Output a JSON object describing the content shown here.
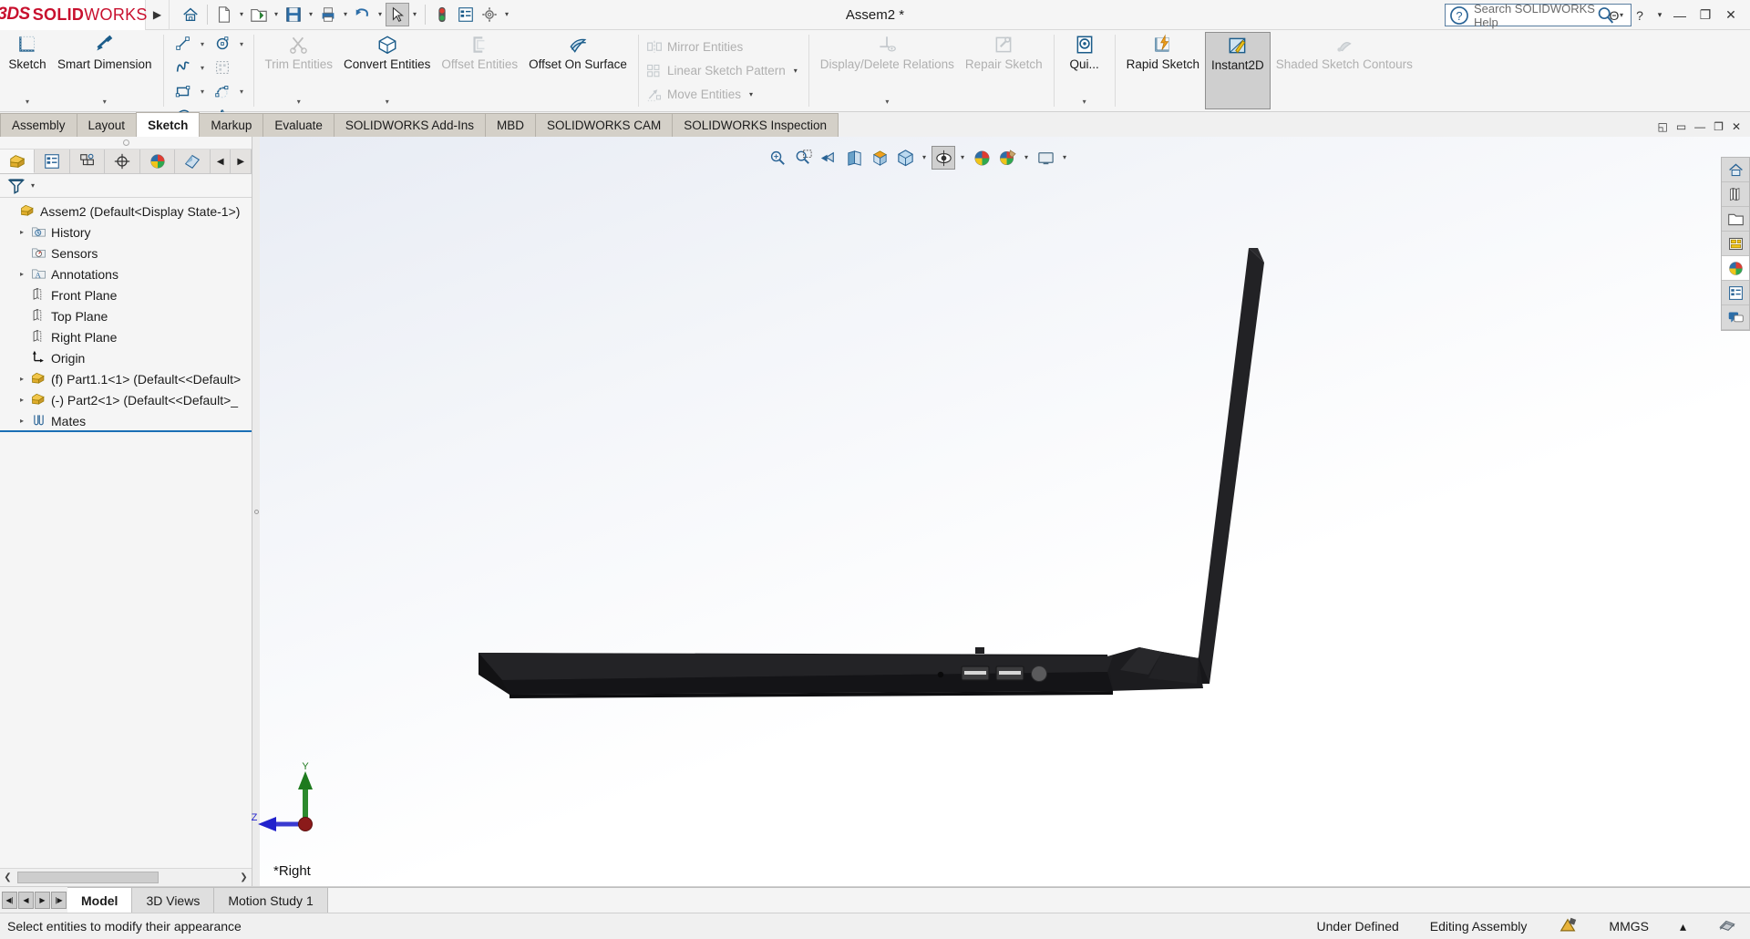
{
  "titlebar": {
    "logo_ds": "3DS",
    "logo_solid": "SOLID",
    "logo_works": "WORKS",
    "expand_arrow": "▶",
    "document_title": "Assem2 *",
    "quick_access": [
      {
        "name": "home-icon",
        "label": "Home",
        "caret": false
      },
      {
        "name": "new-document-icon",
        "label": "New",
        "caret": true
      },
      {
        "name": "open-folder-icon",
        "label": "Open",
        "caret": true
      },
      {
        "name": "save-icon",
        "label": "Save",
        "caret": true
      },
      {
        "name": "print-icon",
        "label": "Print",
        "caret": true
      },
      {
        "name": "undo-icon",
        "label": "Undo",
        "caret": true
      },
      {
        "name": "select-cursor-icon",
        "label": "Select",
        "caret": true
      },
      {
        "name": "rebuild-icon",
        "label": "Rebuild",
        "caret": false
      },
      {
        "name": "options-list-icon",
        "label": "File Properties",
        "caret": false
      },
      {
        "name": "gear-icon",
        "label": "Options",
        "caret": true
      }
    ],
    "search_placeholder": "Search SOLIDWORKS Help",
    "search_value": "",
    "search_icon": "search-magnifier-icon",
    "window_buttons": [
      {
        "name": "user-account-icon",
        "glyph": "Θ"
      },
      {
        "name": "help-icon",
        "glyph": "?"
      },
      {
        "name": "help-caret-icon",
        "glyph": "▾"
      },
      {
        "name": "minimize-button",
        "glyph": "—"
      },
      {
        "name": "restore-button",
        "glyph": "❐"
      },
      {
        "name": "close-button",
        "glyph": "✕"
      }
    ]
  },
  "ribbon": {
    "groups": [
      {
        "type": "big",
        "buttons": [
          {
            "label": "Sketch",
            "icon": "sketch-icon",
            "dropdown": true,
            "enabled": true,
            "active": false
          },
          {
            "label": "Smart Dimension",
            "icon": "smart-dimension-icon",
            "dropdown": true,
            "enabled": true,
            "active": false
          }
        ]
      },
      {
        "type": "grid",
        "cells": [
          {
            "icon": "line-icon",
            "caret": true
          },
          {
            "icon": "circle-icon",
            "caret": true
          },
          {
            "icon": "spline-icon",
            "caret": true
          },
          {
            "icon": "sketch-fillet-pattern-icon",
            "caret": false
          },
          {
            "icon": "rectangle-icon",
            "caret": true
          },
          {
            "icon": "arc-icon",
            "caret": true
          },
          {
            "icon": "ellipse-icon",
            "caret": true
          },
          {
            "icon": "text-icon",
            "caret": false
          },
          {
            "icon": "slot-icon",
            "caret": true
          },
          {
            "icon": "polygon-icon",
            "caret": true
          },
          {
            "icon": "fillet-corner-icon",
            "caret": true
          },
          {
            "icon": "point-icon",
            "caret": false
          }
        ]
      },
      {
        "type": "big",
        "buttons": [
          {
            "label": "Trim Entities",
            "icon": "trim-entities-icon",
            "dropdown": true,
            "enabled": false,
            "active": false
          },
          {
            "label": "Convert Entities",
            "icon": "convert-entities-icon",
            "dropdown": true,
            "enabled": true,
            "active": false
          },
          {
            "label": "Offset Entities",
            "icon": "offset-entities-icon",
            "dropdown": false,
            "enabled": false,
            "active": false
          },
          {
            "label": "Offset On Surface",
            "icon": "offset-on-surface-icon",
            "dropdown": false,
            "enabled": true,
            "active": false
          }
        ]
      },
      {
        "type": "textlist",
        "items": [
          {
            "label": "Mirror Entities",
            "icon": "mirror-entities-icon",
            "caret": false,
            "enabled": false
          },
          {
            "label": "Linear Sketch Pattern",
            "icon": "linear-sketch-pattern-icon",
            "caret": true,
            "enabled": false
          },
          {
            "label": "Move Entities",
            "icon": "move-entities-icon",
            "caret": true,
            "enabled": false
          }
        ]
      },
      {
        "type": "big",
        "buttons": [
          {
            "label": "Display/Delete Relations",
            "icon": "display-delete-relations-icon",
            "dropdown": true,
            "enabled": false,
            "active": false
          },
          {
            "label": "Repair Sketch",
            "icon": "repair-sketch-icon",
            "dropdown": false,
            "enabled": false,
            "active": false
          }
        ]
      },
      {
        "type": "big",
        "buttons": [
          {
            "label": "Qui...",
            "icon": "quick-snaps-icon",
            "dropdown": true,
            "enabled": true,
            "active": false
          }
        ]
      },
      {
        "type": "big",
        "buttons": [
          {
            "label": "Rapid Sketch",
            "icon": "rapid-sketch-icon",
            "dropdown": false,
            "enabled": true,
            "active": false
          },
          {
            "label": "Instant2D",
            "icon": "instant2d-icon",
            "dropdown": false,
            "enabled": true,
            "active": true
          },
          {
            "label": "Shaded Sketch Contours",
            "icon": "shaded-sketch-contours-icon",
            "dropdown": false,
            "enabled": false,
            "active": false
          }
        ]
      }
    ]
  },
  "command_tabs": {
    "tabs": [
      {
        "label": "Assembly",
        "selected": false
      },
      {
        "label": "Layout",
        "selected": false
      },
      {
        "label": "Sketch",
        "selected": true
      },
      {
        "label": "Markup",
        "selected": false
      },
      {
        "label": "Evaluate",
        "selected": false
      },
      {
        "label": "SOLIDWORKS Add-Ins",
        "selected": false
      },
      {
        "label": "MBD",
        "selected": false
      },
      {
        "label": "SOLIDWORKS CAM",
        "selected": false
      },
      {
        "label": "SOLIDWORKS Inspection",
        "selected": false
      }
    ],
    "window_controls": [
      {
        "name": "pin-panel-icon",
        "glyph": "◱"
      },
      {
        "name": "doc-minimize-icon",
        "glyph": "▭"
      },
      {
        "name": "doc-minimize-button",
        "glyph": "—"
      },
      {
        "name": "doc-restore-button",
        "glyph": "❐"
      },
      {
        "name": "doc-close-button",
        "glyph": "✕"
      }
    ]
  },
  "left_panel": {
    "tree_tabs": [
      {
        "name": "feature-manager-tab",
        "icon": "yellow-block-icon",
        "selected": true
      },
      {
        "name": "property-manager-tab",
        "icon": "property-list-icon",
        "selected": false
      },
      {
        "name": "configuration-manager-tab",
        "icon": "configuration-icon",
        "selected": false
      },
      {
        "name": "dimxpert-manager-tab",
        "icon": "dimxpert-target-icon",
        "selected": false
      },
      {
        "name": "display-manager-tab",
        "icon": "appearance-sphere-icon",
        "selected": false
      },
      {
        "name": "render-manager-tab",
        "icon": "render-pages-icon",
        "selected": false
      }
    ],
    "tab_scroll_left": "◀",
    "tab_scroll_right": "▶",
    "filter_icon": "filter-funnel-icon",
    "filter_caret": "▾",
    "tree_items": [
      {
        "label": "Assem2  (Default<Display State-1>)",
        "icon": "assembly-icon",
        "indent": 0,
        "expander": ""
      },
      {
        "label": "History",
        "icon": "history-folder-icon",
        "indent": 1,
        "expander": "▸"
      },
      {
        "label": "Sensors",
        "icon": "sensors-icon",
        "indent": 1,
        "expander": ""
      },
      {
        "label": "Annotations",
        "icon": "annotations-icon",
        "indent": 1,
        "expander": "▸"
      },
      {
        "label": "Front Plane",
        "icon": "plane-icon",
        "indent": 1,
        "expander": ""
      },
      {
        "label": "Top Plane",
        "icon": "plane-icon",
        "indent": 1,
        "expander": ""
      },
      {
        "label": "Right Plane",
        "icon": "plane-icon",
        "indent": 1,
        "expander": ""
      },
      {
        "label": "Origin",
        "icon": "origin-icon",
        "indent": 1,
        "expander": ""
      },
      {
        "label": "(f) Part1.1<1>  (Default<<Default>",
        "icon": "part-icon",
        "indent": 1,
        "expander": "▸"
      },
      {
        "label": "(-) Part2<1>  (Default<<Default>_",
        "icon": "part-icon",
        "indent": 1,
        "expander": "▸"
      },
      {
        "label": "Mates",
        "icon": "mates-icon",
        "indent": 1,
        "expander": "▸"
      }
    ],
    "hscroll_left": "❮",
    "hscroll_right": "❯"
  },
  "graphics": {
    "view_label": "*Right",
    "view_toolbar": [
      {
        "name": "zoom-to-fit-icon",
        "caret": false,
        "selected": false
      },
      {
        "name": "zoom-to-area-icon",
        "caret": false,
        "selected": false
      },
      {
        "name": "previous-view-icon",
        "caret": false,
        "selected": false
      },
      {
        "name": "section-view-icon",
        "caret": false,
        "selected": false
      },
      {
        "name": "view-orientation-icon",
        "caret": false,
        "selected": false
      },
      {
        "name": "display-style-cube-icon",
        "caret": true,
        "selected": false
      },
      {
        "name": "view-settings-icon",
        "caret": true,
        "selected": true
      },
      {
        "name": "hide-show-items-icon",
        "caret": false,
        "selected": false
      },
      {
        "name": "apply-scene-icon",
        "caret": true,
        "selected": false
      },
      {
        "name": "view-setting-display-icon",
        "caret": true,
        "selected": false
      }
    ],
    "triad": {
      "y_label": "Y",
      "z_label": "Z",
      "y_color": "#1e7a1e",
      "z_color": "#2222cc",
      "origin_color": "#8b1a1a"
    },
    "model_color": "#1a1a1a",
    "right_toolbar": [
      {
        "name": "view-palette-home-icon",
        "selected": false
      },
      {
        "name": "appearances-library-icon",
        "selected": false
      },
      {
        "name": "file-explorer-icon",
        "selected": false
      },
      {
        "name": "view-palette-icon",
        "selected": false
      },
      {
        "name": "appearances-scenes-icon",
        "selected": true
      },
      {
        "name": "custom-properties-icon",
        "selected": false
      },
      {
        "name": "solidworks-forum-icon",
        "selected": false
      }
    ]
  },
  "bottom": {
    "nav_buttons": [
      {
        "name": "first-tab-button",
        "glyph": "◀|"
      },
      {
        "name": "prev-tab-button",
        "glyph": "◀"
      },
      {
        "name": "next-tab-button",
        "glyph": "▶"
      },
      {
        "name": "last-tab-button",
        "glyph": "|▶"
      }
    ],
    "tabs": [
      {
        "label": "Model",
        "selected": true
      },
      {
        "label": "3D Views",
        "selected": false
      },
      {
        "label": "Motion Study 1",
        "selected": false
      }
    ]
  },
  "statusbar": {
    "message": "Select entities to modify their appearance",
    "state": "Under Defined",
    "mode": "Editing Assembly",
    "edit_icon": "edit-assembly-icon",
    "units": "MMGS",
    "units_caret": "▴",
    "overlay_icon": "overlay-icon"
  }
}
